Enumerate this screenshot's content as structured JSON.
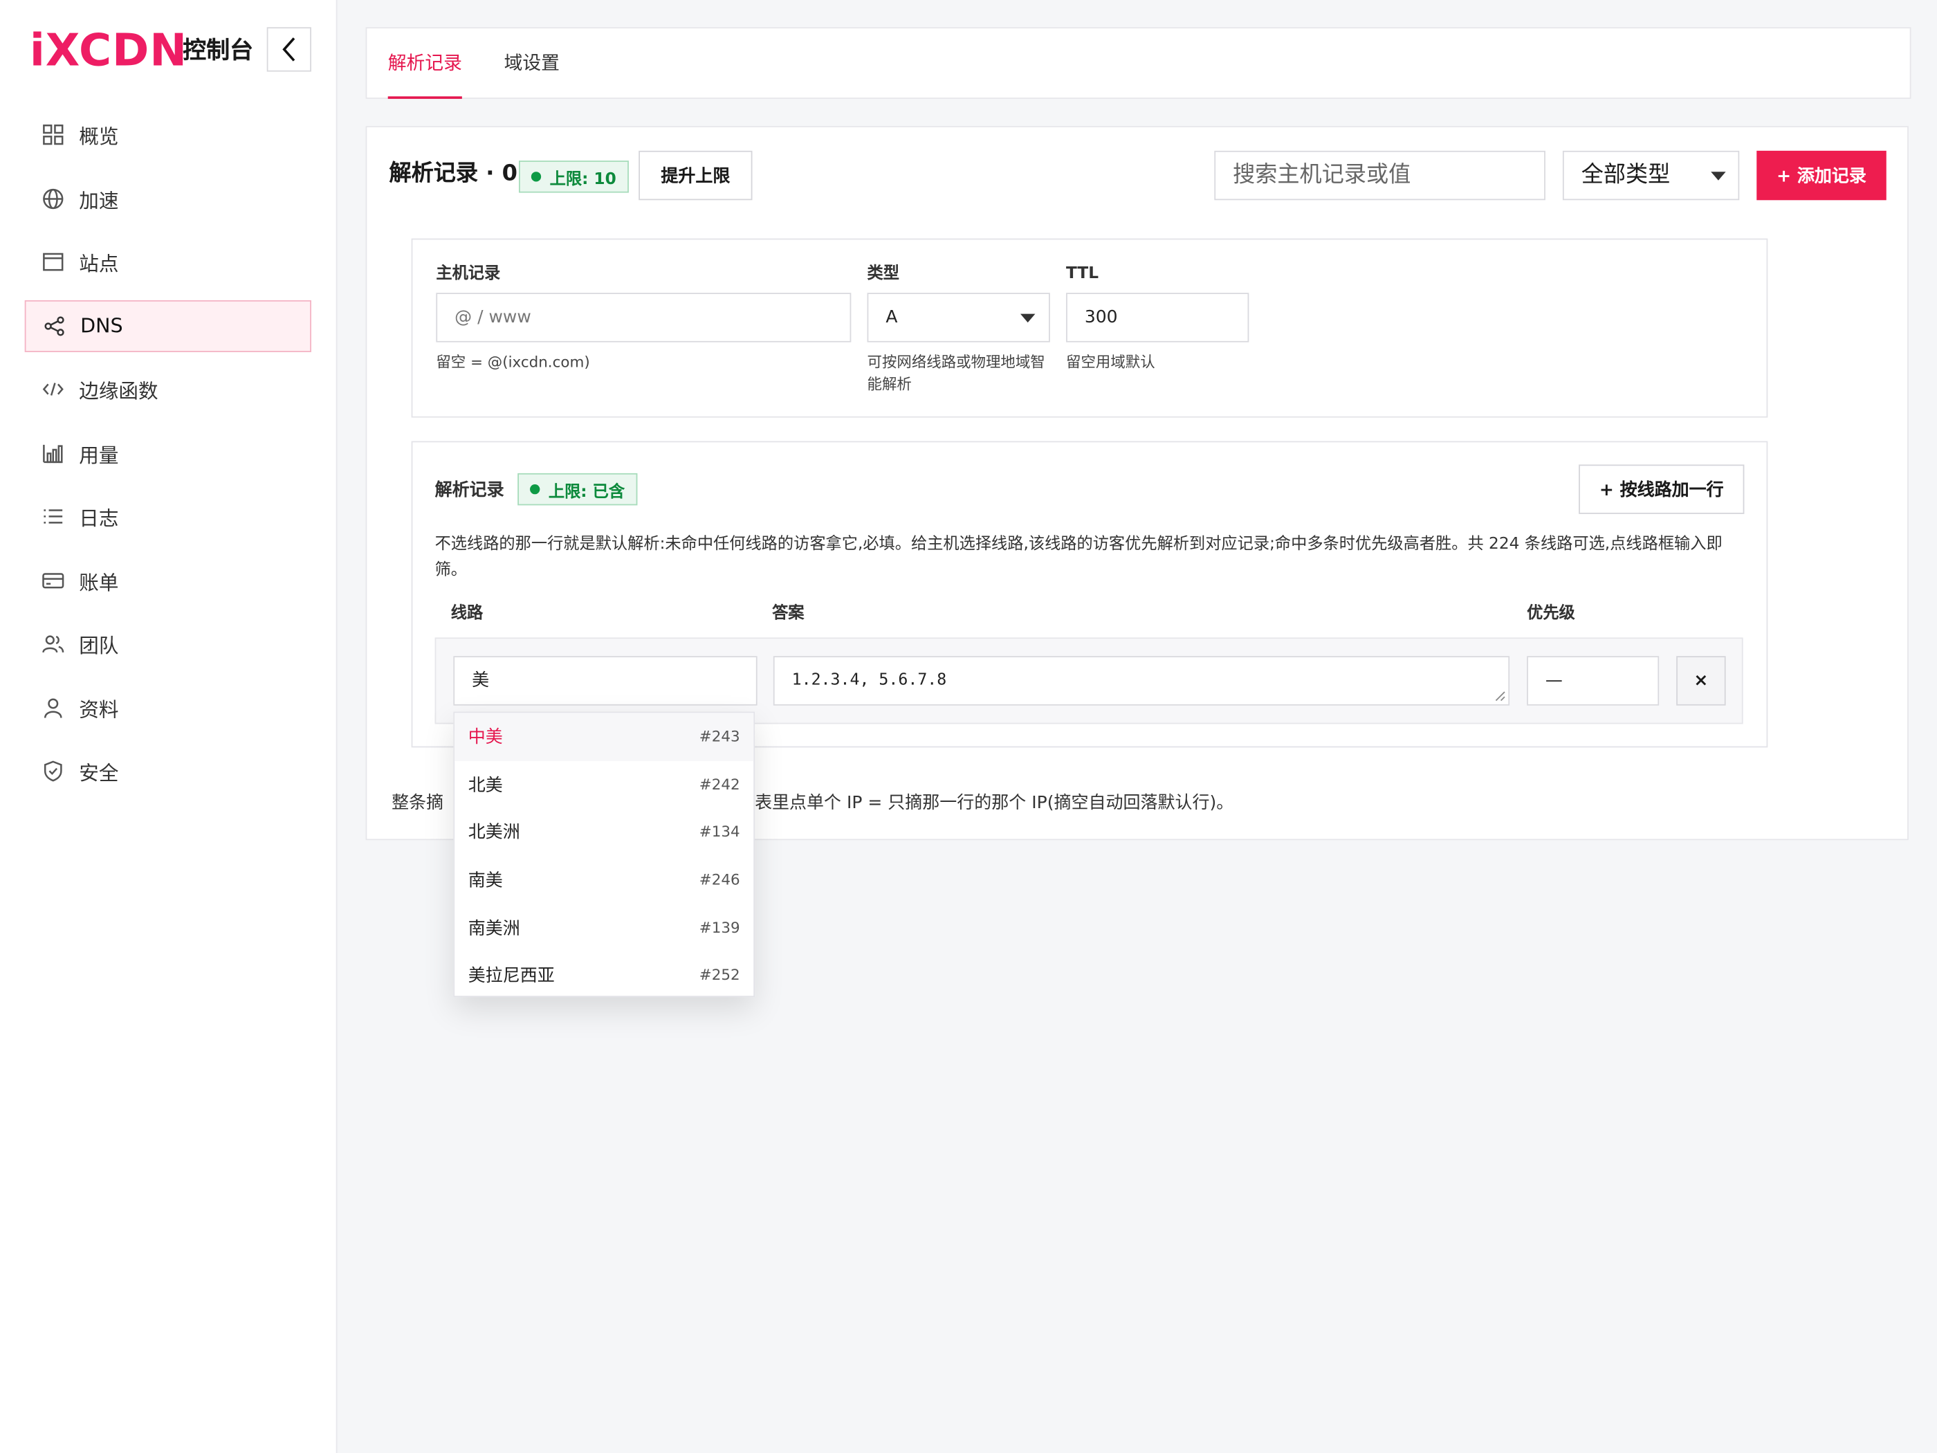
{
  "brand": {
    "logo": "iXCDN",
    "console": "控制台"
  },
  "sidebar": {
    "items": [
      {
        "label": "概览",
        "icon": "grid-icon"
      },
      {
        "label": "加速",
        "icon": "globe-icon"
      },
      {
        "label": "站点",
        "icon": "window-icon"
      },
      {
        "label": "DNS",
        "icon": "share-icon",
        "active": true
      },
      {
        "label": "边缘函数",
        "icon": "code-icon"
      },
      {
        "label": "用量",
        "icon": "bar-chart-icon"
      },
      {
        "label": "日志",
        "icon": "list-icon"
      },
      {
        "label": "账单",
        "icon": "card-icon"
      },
      {
        "label": "团队",
        "icon": "team-icon"
      },
      {
        "label": "资料",
        "icon": "user-icon"
      },
      {
        "label": "安全",
        "icon": "shield-icon"
      }
    ]
  },
  "tabs": [
    {
      "label": "解析记录",
      "active": true
    },
    {
      "label": "域设置"
    }
  ],
  "toolbar": {
    "title": "解析记录 · 0",
    "limit_badge": "上限: 10",
    "raise_limit": "提升上限",
    "search_placeholder": "搜索主机记录或值",
    "type_filter": "全部类型",
    "add_record": "+ 添加记录"
  },
  "form": {
    "host_label": "主机记录",
    "host_placeholder": "@ / www",
    "host_hint": "留空 = @(ixcdn.com)",
    "type_label": "类型",
    "type_value": "A",
    "type_hint": "可按网络线路或物理地域智能解析",
    "ttl_label": "TTL",
    "ttl_value": "300",
    "ttl_hint": "留空用域默认"
  },
  "records": {
    "title": "解析记录",
    "badge": "上限: 已含",
    "add_line": "+ 按线路加一行",
    "description": "不选线路的那一行就是默认解析:未命中任何线路的访客拿它,必填。给主机选择线路,该线路的访客优先解析到对应记录;命中多条时优先级高者胜。共 224 条线路可选,点线路框输入即筛。",
    "col_line": "线路",
    "col_answer": "答案",
    "col_priority": "优先级",
    "row": {
      "line": "美",
      "answer": "1.2.3.4, 5.6.7.8",
      "priority": "—",
      "remove": "×"
    }
  },
  "footer_left": "整条摘",
  "footer_right": "表里点单个 IP = 只摘那一行的那个 IP(摘空自动回落默认行)。",
  "dropdown": [
    {
      "name": "中美",
      "code": "#243"
    },
    {
      "name": "北美",
      "code": "#242"
    },
    {
      "name": "北美洲",
      "code": "#134"
    },
    {
      "name": "南美",
      "code": "#246"
    },
    {
      "name": "南美洲",
      "code": "#139"
    },
    {
      "name": "美拉尼西亚",
      "code": "#252"
    }
  ],
  "colors": {
    "brand": "#ee1d64",
    "accent": "#e5164e",
    "success": "#0d8a3c"
  }
}
